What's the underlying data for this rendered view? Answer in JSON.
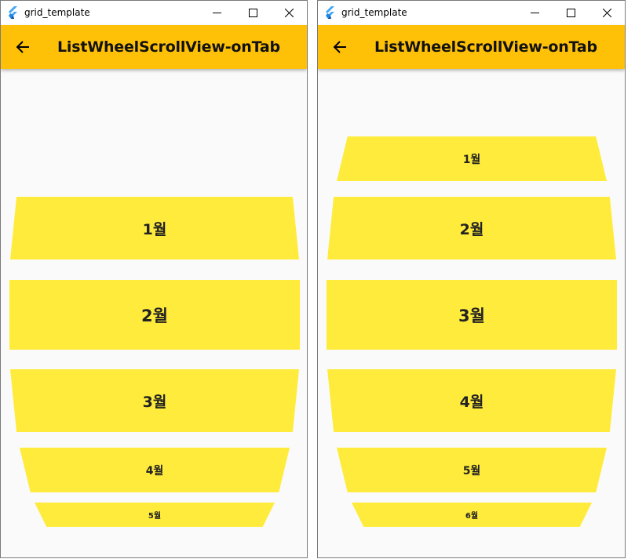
{
  "colors": {
    "appbar": "#ffc107",
    "item": "#ffeb3b",
    "background": "#fafafa",
    "window_border": "#7a7a7a"
  },
  "windows": [
    {
      "title": "grid_template",
      "app_bar_title": "ListWheelScrollView-onTab",
      "items": [
        {
          "label": "1월"
        },
        {
          "label": "2월"
        },
        {
          "label": "3월"
        },
        {
          "label": "4월"
        },
        {
          "label": "5월"
        }
      ]
    },
    {
      "title": "grid_template",
      "app_bar_title": "ListWheelScrollView-onTab",
      "items": [
        {
          "label": "1월"
        },
        {
          "label": "2월"
        },
        {
          "label": "3월"
        },
        {
          "label": "4월"
        },
        {
          "label": "5월"
        },
        {
          "label": "6월"
        }
      ]
    }
  ],
  "icons": {
    "app": "flutter-logo-icon",
    "minimize": "minimize-icon",
    "maximize": "maximize-icon",
    "close": "close-icon",
    "back": "arrow-left-icon"
  }
}
